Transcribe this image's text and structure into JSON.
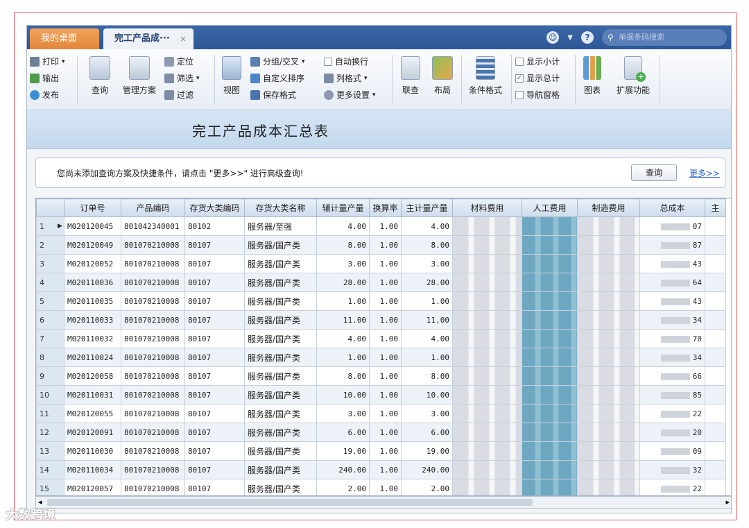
{
  "tabs": {
    "home": "我的桌面",
    "active": "完工产品成···",
    "close": "×"
  },
  "search": {
    "placeholder": "单据条码搜索"
  },
  "toolbar": {
    "print": "打印",
    "export": "输出",
    "publish": "发布",
    "query": "查询",
    "manage_plan": "管理方案",
    "locate": "定位",
    "filter": "筛选",
    "filter2": "过滤",
    "view": "视图",
    "group_cross": "分组/交叉",
    "custom_sort": "自定义排序",
    "save_format": "保存格式",
    "auto_wrap": "自动换行",
    "column_format": "列格式",
    "more_settings": "更多设置",
    "linked_query": "联查",
    "layout": "布局",
    "conditional_format": "条件格式",
    "show_subtotal": "显示小计",
    "show_total": "显示总计",
    "nav_pane": "导航窗格",
    "chart": "图表",
    "extend": "扩展功能"
  },
  "report": {
    "title": "完工产品成本汇总表",
    "hint": "您尚未添加查询方案及快捷条件，请点击 \"更多>>\" 进行高级查询!",
    "query_button": "查询",
    "more_link": "更多>>"
  },
  "columns": [
    "订单号",
    "产品编码",
    "存货大类编码",
    "存货大类名称",
    "辅计量产量",
    "换算率",
    "主计量产量",
    "材料费用",
    "人工费用",
    "制造费用",
    "总成本",
    "主"
  ],
  "rows": [
    {
      "n": "1",
      "order": "M020120045",
      "code": "801042340001",
      "cat": "80102",
      "name": "服务器/至强",
      "aux": "4.00",
      "rate": "1.00",
      "main": "4.00",
      "tail": "07"
    },
    {
      "n": "2",
      "order": "M020120049",
      "code": "801070210008",
      "cat": "80107",
      "name": "服务器/国产类",
      "aux": "8.00",
      "rate": "1.00",
      "main": "8.00",
      "tail": "87"
    },
    {
      "n": "3",
      "order": "M020120052",
      "code": "801070210008",
      "cat": "80107",
      "name": "服务器/国产类",
      "aux": "3.00",
      "rate": "1.00",
      "main": "3.00",
      "tail": "43"
    },
    {
      "n": "4",
      "order": "M020110036",
      "code": "801070210008",
      "cat": "80107",
      "name": "服务器/国产类",
      "aux": "28.00",
      "rate": "1.00",
      "main": "28.00",
      "tail": "64"
    },
    {
      "n": "5",
      "order": "M020110035",
      "code": "801070210008",
      "cat": "80107",
      "name": "服务器/国产类",
      "aux": "1.00",
      "rate": "1.00",
      "main": "1.00",
      "tail": "43"
    },
    {
      "n": "6",
      "order": "M020110033",
      "code": "801070210008",
      "cat": "80107",
      "name": "服务器/国产类",
      "aux": "11.00",
      "rate": "1.00",
      "main": "11.00",
      "tail": "34"
    },
    {
      "n": "7",
      "order": "M020110032",
      "code": "801070210008",
      "cat": "80107",
      "name": "服务器/国产类",
      "aux": "4.00",
      "rate": "1.00",
      "main": "4.00",
      "tail": "70"
    },
    {
      "n": "8",
      "order": "M020110024",
      "code": "801070210008",
      "cat": "80107",
      "name": "服务器/国产类",
      "aux": "1.00",
      "rate": "1.00",
      "main": "1.00",
      "tail": "34"
    },
    {
      "n": "9",
      "order": "M020120058",
      "code": "801070210008",
      "cat": "80107",
      "name": "服务器/国产类",
      "aux": "8.00",
      "rate": "1.00",
      "main": "8.00",
      "tail": "66"
    },
    {
      "n": "10",
      "order": "M020110031",
      "code": "801070210008",
      "cat": "80107",
      "name": "服务器/国产类",
      "aux": "10.00",
      "rate": "1.00",
      "main": "10.00",
      "tail": "85"
    },
    {
      "n": "11",
      "order": "M020120055",
      "code": "801070210008",
      "cat": "80107",
      "name": "服务器/国产类",
      "aux": "3.00",
      "rate": "1.00",
      "main": "3.00",
      "tail": "22"
    },
    {
      "n": "12",
      "order": "M020120091",
      "code": "801070210008",
      "cat": "80107",
      "name": "服务器/国产类",
      "aux": "6.00",
      "rate": "1.00",
      "main": "6.00",
      "tail": "20"
    },
    {
      "n": "13",
      "order": "M020110030",
      "code": "801070210008",
      "cat": "80107",
      "name": "服务器/国产类",
      "aux": "19.00",
      "rate": "1.00",
      "main": "19.00",
      "tail": "09"
    },
    {
      "n": "14",
      "order": "M020110034",
      "code": "801070210008",
      "cat": "80107",
      "name": "服务器/国产类",
      "aux": "240.00",
      "rate": "1.00",
      "main": "240.00",
      "tail": "32"
    },
    {
      "n": "15",
      "order": "M020120057",
      "code": "801070210008",
      "cat": "80107",
      "name": "服务器/国产类",
      "aux": "2.00",
      "rate": "1.00",
      "main": "2.00",
      "tail": "22"
    }
  ],
  "watermark": "大数跨境",
  "colors": {
    "accent": "#2c5696",
    "tab_home": "#e2863a",
    "highlight_col": "#8fbfd3"
  }
}
